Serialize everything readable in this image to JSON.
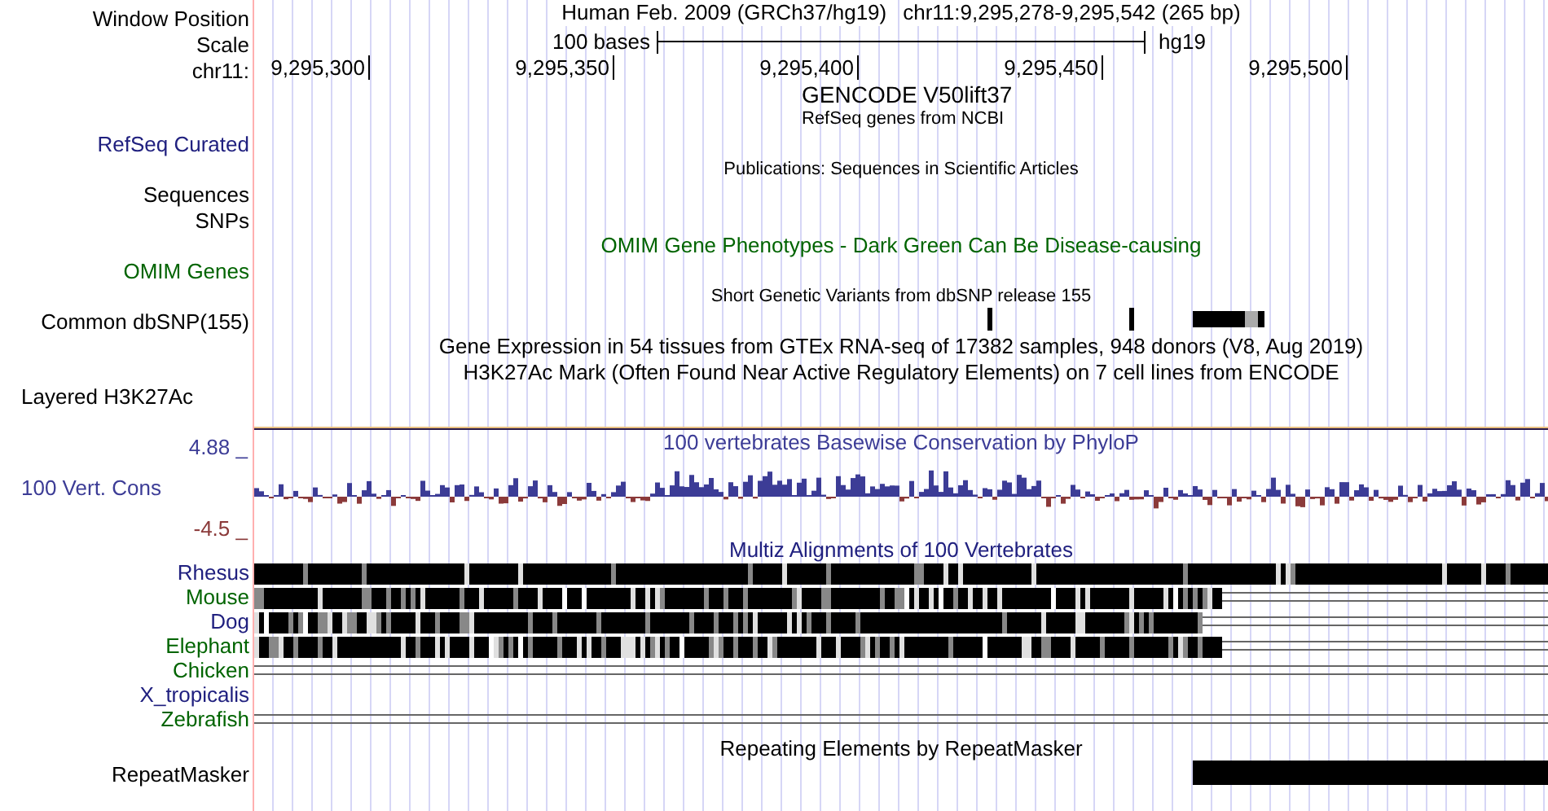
{
  "labels": [
    {
      "kind": "header",
      "text": "Window Position",
      "color": "#000000"
    },
    {
      "kind": "header",
      "text": "Scale",
      "color": "#000000"
    },
    {
      "kind": "header",
      "text": "chr11:",
      "color": "#000000"
    },
    {
      "kind": "track",
      "text": "RefSeq Curated",
      "color": "#20207f"
    },
    {
      "kind": "track",
      "text": "Sequences",
      "color": "#000000"
    },
    {
      "kind": "track",
      "text": "SNPs",
      "color": "#000000"
    },
    {
      "kind": "track",
      "text": "OMIM Genes",
      "color": "#006400"
    },
    {
      "kind": "track",
      "text": "Common dbSNP(155)",
      "color": "#000000"
    },
    {
      "kind": "composite",
      "text": "Layered H3K27Ac",
      "color": "#000000"
    },
    {
      "kind": "axis",
      "text": "4.88 _",
      "color": "#3c3c96"
    },
    {
      "kind": "wiggle",
      "text": "100 Vert. Cons",
      "color": "#3c3c96"
    },
    {
      "kind": "axis",
      "text": "-4.5 _",
      "color": "#8b3a3a"
    },
    {
      "kind": "species",
      "text": "Rhesus",
      "color": "#20207f"
    },
    {
      "kind": "species",
      "text": "Mouse",
      "color": "#006400"
    },
    {
      "kind": "species",
      "text": "Dog",
      "color": "#20207f"
    },
    {
      "kind": "species",
      "text": "Elephant",
      "color": "#006400"
    },
    {
      "kind": "species",
      "text": "Chicken",
      "color": "#006400"
    },
    {
      "kind": "species",
      "text": "X_tropicalis",
      "color": "#20207f"
    },
    {
      "kind": "species",
      "text": "Zebrafish",
      "color": "#006400"
    },
    {
      "kind": "track",
      "text": "RepeatMasker",
      "color": "#000000"
    }
  ],
  "title": {
    "assembly": "Human Feb. 2009 (GRCh37/hg19)",
    "position": "chr11:9,295,278-9,295,542 (265 bp)"
  },
  "scale": {
    "text": "100 bases",
    "assembly": "hg19"
  },
  "ruler": {
    "ticks": [
      "9,295,300",
      "9,295,350",
      "9,295,400",
      "9,295,450",
      "9,295,500"
    ]
  },
  "tracks": {
    "gencode_title": "GENCODE V50lift37",
    "refseq_title": "RefSeq genes from NCBI",
    "publications_title": "Publications: Sequences in Scientific Articles",
    "omim_title": "OMIM Gene Phenotypes - Dark Green Can Be Disease-causing",
    "dbsnp_title": "Short Genetic Variants from dbSNP release 155",
    "gtex_title": "Gene Expression in 54 tissues from GTEx RNA-seq of 17382 samples, 948 donors (V8, Aug 2019)",
    "h3k27ac_title": "H3K27Ac Mark (Often Found Near Active Regulatory Elements) on 7 cell lines from ENCODE",
    "phylop_title": "100 vertebrates Basewise Conservation by PhyloP",
    "multiz_title": "Multiz Alignments of 100 Vertebrates",
    "repeatmasker_title": "Repeating Elements by RepeatMasker"
  }
}
